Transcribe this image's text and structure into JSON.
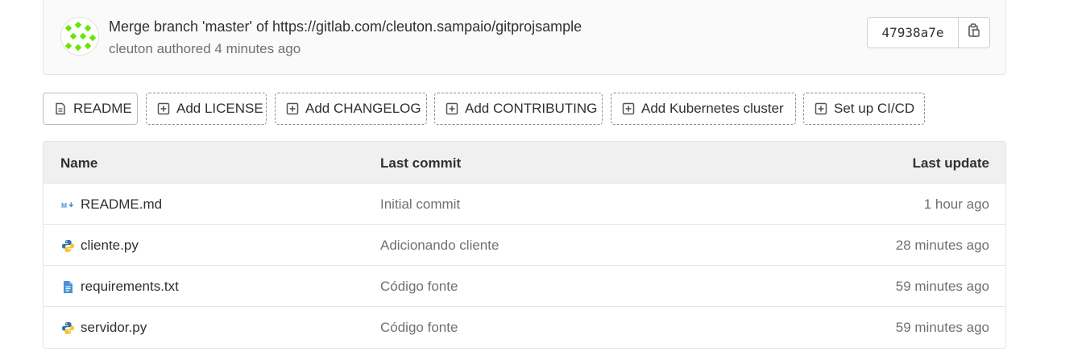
{
  "commit": {
    "title": "Merge branch 'master' of https://gitlab.com/cleuton.sampaio/gitprojsample",
    "author": "cleuton",
    "authored_text": "authored",
    "time": "4 minutes ago",
    "sha": "47938a7e",
    "copy_icon": "clipboard-icon"
  },
  "actions": [
    {
      "label": "README",
      "icon": "file-icon"
    },
    {
      "label": "Add LICENSE",
      "icon": "plus-square-icon"
    },
    {
      "label": "Add CHANGELOG",
      "icon": "plus-square-icon"
    },
    {
      "label": "Add CONTRIBUTING",
      "icon": "plus-square-icon"
    },
    {
      "label": "Add Kubernetes cluster",
      "icon": "plus-square-icon"
    },
    {
      "label": "Set up CI/CD",
      "icon": "plus-square-icon"
    }
  ],
  "table": {
    "headers": {
      "name": "Name",
      "last_commit": "Last commit",
      "last_update": "Last update"
    },
    "rows": [
      {
        "name": "README.md",
        "icon": "markdown-icon",
        "commit": "Initial commit",
        "update": "1 hour ago"
      },
      {
        "name": "cliente.py",
        "icon": "python-icon",
        "commit": "Adicionando cliente",
        "update": "28 minutes ago"
      },
      {
        "name": "requirements.txt",
        "icon": "text-file-icon",
        "commit": "Código fonte",
        "update": "59 minutes ago"
      },
      {
        "name": "servidor.py",
        "icon": "python-icon",
        "commit": "Código fonte",
        "update": "59 minutes ago"
      }
    ]
  },
  "colors": {
    "avatar_green": "#66e600",
    "python_blue": "#3572a5",
    "python_yellow": "#f7c42c",
    "file_blue": "#4a90d9"
  }
}
